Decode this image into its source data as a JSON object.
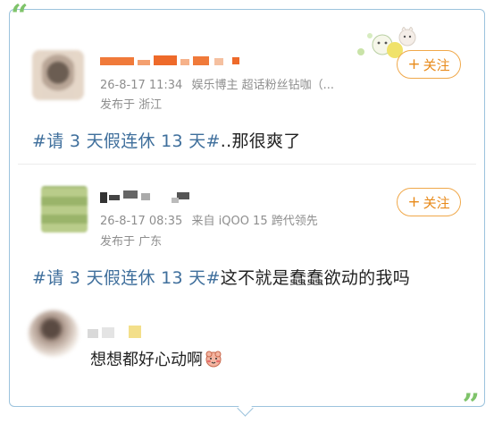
{
  "post1": {
    "name": "",
    "timestamp": "26-8-17 11:34",
    "badge": "娱乐博主 超话粉丝钻咖（...",
    "location": "发布于 浙江",
    "follow_label": "关注",
    "hashtag": "#请 3 天假连休 13 天#",
    "text": "..那很爽了"
  },
  "post2": {
    "name": "",
    "timestamp": "26-8-17 08:35",
    "source": "来自 iQOO 15 跨代领先",
    "location": "发布于 广东",
    "follow_label": "关注",
    "hashtag": "#请 3 天假连休 13 天#",
    "text": "这不就是蠢蠢欲动的我吗"
  },
  "comment": {
    "text": "想想都好心动啊"
  },
  "colors": {
    "hashtag": "#3f6f9c",
    "follow_accent": "#e88a1a",
    "frame_border": "#9cc3dd",
    "quote_marks": "#7fc36a"
  },
  "icons": {
    "follow_plus": "plus-icon",
    "sticker": "decorative-bunny-sticker",
    "comment_emoji": "blushing-face-emoji"
  }
}
